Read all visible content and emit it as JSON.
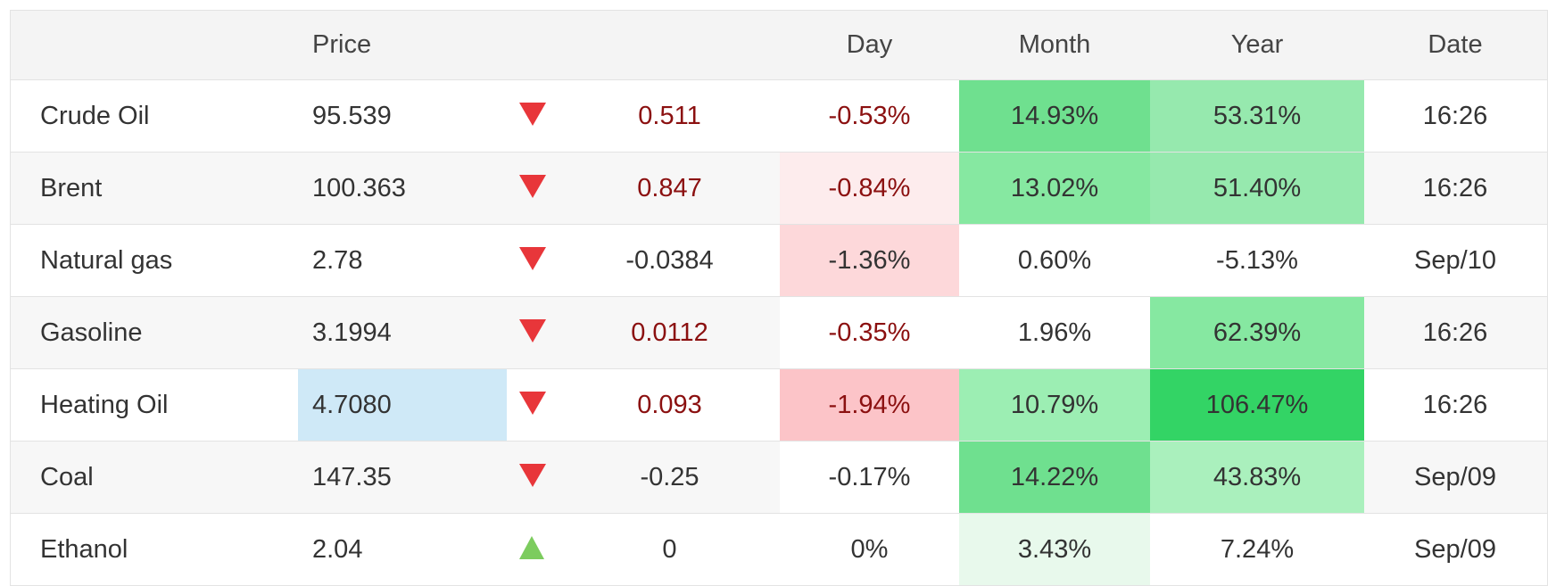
{
  "header": {
    "name": "",
    "price": "Price",
    "arrow": "",
    "change": "",
    "day": "Day",
    "month": "Month",
    "year": "Year",
    "date": "Date"
  },
  "colors": {
    "change_positive_text": "#8b1010",
    "price_highlight": "#cfe9f7",
    "arrow_down": "#e8363a",
    "arrow_up": "#7ccc5e"
  },
  "rows": [
    {
      "name": "Crude Oil",
      "price": "95.539",
      "direction": "down",
      "change": "0.511",
      "day": "-0.53%",
      "month": "14.93%",
      "year": "53.31%",
      "date": "16:26",
      "price_bg": "",
      "change_red": true,
      "day_bg": "",
      "month_bg": "#6fe08f",
      "year_bg": "#96e9ae"
    },
    {
      "name": "Brent",
      "price": "100.363",
      "direction": "down",
      "change": "0.847",
      "day": "-0.84%",
      "month": "13.02%",
      "year": "51.40%",
      "date": "16:26",
      "price_bg": "",
      "change_red": true,
      "day_bg": "#fdeced",
      "month_bg": "#86e8a1",
      "year_bg": "#96e9ae"
    },
    {
      "name": "Natural gas",
      "price": "2.78",
      "direction": "down",
      "change": "-0.0384",
      "day": "-1.36%",
      "month": "0.60%",
      "year": "-5.13%",
      "date": "Sep/10",
      "price_bg": "",
      "change_red": false,
      "day_bg": "#fdd8da",
      "month_bg": "",
      "year_bg": ""
    },
    {
      "name": "Gasoline",
      "price": "3.1994",
      "direction": "down",
      "change": "0.0112",
      "day": "-0.35%",
      "month": "1.96%",
      "year": "62.39%",
      "date": "16:26",
      "price_bg": "",
      "change_red": true,
      "day_bg": "#ffffff",
      "month_bg": "#ffffff",
      "year_bg": "#86e8a1"
    },
    {
      "name": "Heating Oil",
      "price": "4.7080",
      "direction": "down",
      "change": "0.093",
      "day": "-1.94%",
      "month": "10.79%",
      "year": "106.47%",
      "date": "16:26",
      "price_bg": "#cfe9f7",
      "change_red": true,
      "day_bg": "#fcc4c8",
      "month_bg": "#9ceeb3",
      "year_bg": "#33d465"
    },
    {
      "name": "Coal",
      "price": "147.35",
      "direction": "down",
      "change": "-0.25",
      "day": "-0.17%",
      "month": "14.22%",
      "year": "43.83%",
      "date": "Sep/09",
      "price_bg": "",
      "change_red": false,
      "day_bg": "#ffffff",
      "month_bg": "#6fe08f",
      "year_bg": "#aaf0bd"
    },
    {
      "name": "Ethanol",
      "price": "2.04",
      "direction": "up",
      "change": "0",
      "day": "0%",
      "month": "3.43%",
      "year": "7.24%",
      "date": "Sep/09",
      "price_bg": "",
      "change_red": false,
      "day_bg": "",
      "month_bg": "#e8f9ec",
      "year_bg": ""
    }
  ]
}
